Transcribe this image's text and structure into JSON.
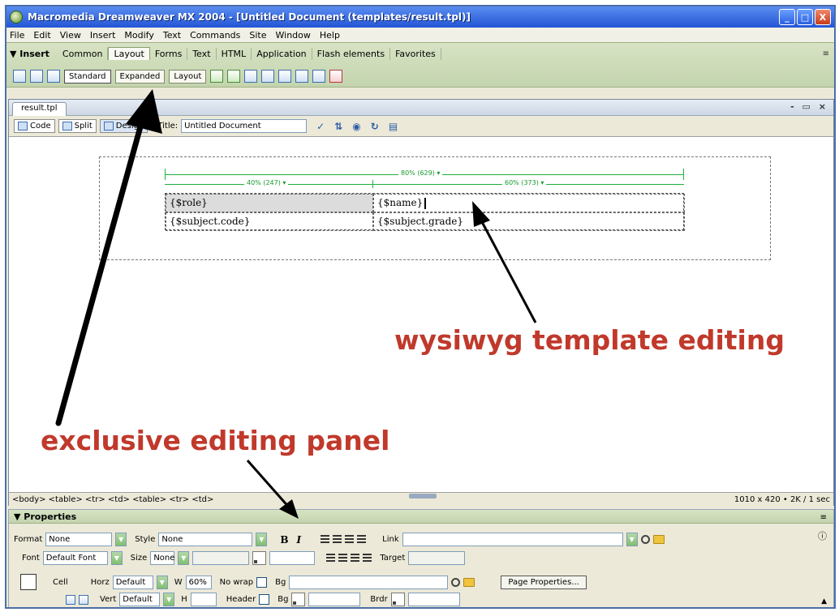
{
  "window": {
    "title": "Macromedia Dreamweaver MX 2004 - [Untitled Document (templates/result.tpl)]",
    "controls": [
      "_",
      "□",
      "X"
    ]
  },
  "menubar": [
    "File",
    "Edit",
    "View",
    "Insert",
    "Modify",
    "Text",
    "Commands",
    "Site",
    "Window",
    "Help"
  ],
  "insert_bar": {
    "panel_title": "▼ Insert",
    "tabs": [
      "Common",
      "Layout",
      "Forms",
      "Text",
      "HTML",
      "Application",
      "Flash elements",
      "Favorites"
    ],
    "active_tab": "Layout",
    "mode_buttons": [
      "Standard",
      "Expanded",
      "Layout"
    ],
    "active_mode": "Standard"
  },
  "document": {
    "tab_label": "result.tpl",
    "view_buttons": [
      "Code",
      "Split",
      "Design"
    ],
    "active_view": "Design",
    "title_label": "Title:",
    "title_value": "Untitled Document",
    "table": {
      "overall_width_label": "80% (629) ▾",
      "col1_width_label": "40% (247) ▾",
      "col2_width_label": "60% (373) ▾",
      "rows": [
        [
          "{$role}",
          "{$name}"
        ],
        [
          "{$subject.code}",
          "{$subject.grade}"
        ]
      ]
    },
    "tag_selector": "<body> <table> <tr> <td> <table> <tr> <td>",
    "status_right": "1010 x 420 • 2K / 1 sec"
  },
  "properties": {
    "header": "▼ Properties",
    "format_label": "Format",
    "format_value": "None",
    "style_label": "Style",
    "style_value": "None",
    "bold_label": "B",
    "italic_label": "I",
    "link_label": "Link",
    "font_label": "Font",
    "font_value": "Default Font",
    "size_label": "Size",
    "size_value": "None",
    "target_label": "Target",
    "cell_label": "Cell",
    "horz_label": "Horz",
    "horz_value": "Default",
    "w_label": "W",
    "w_value": "60%",
    "nowrap_label": "No wrap",
    "bg_label": "Bg",
    "page_properties_button": "Page Properties...",
    "vert_label": "Vert",
    "vert_value": "Default",
    "h_label": "H",
    "header_label": "Header",
    "brdr_label": "Brdr"
  },
  "annotations": {
    "wysiwyg": "wysiwyg template editing",
    "panel": "exclusive editing panel",
    "color": "#c0392b"
  }
}
